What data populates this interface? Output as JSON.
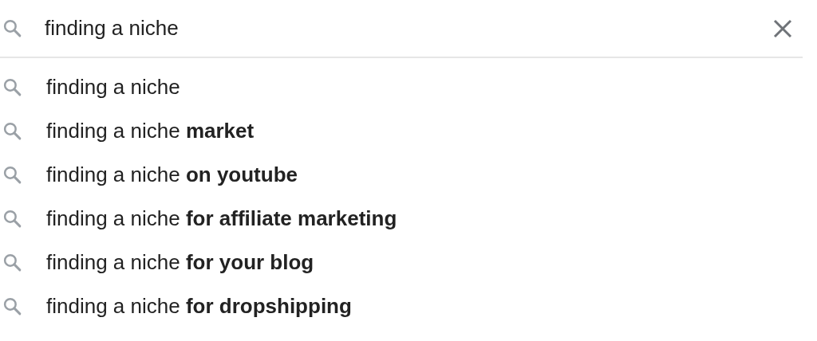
{
  "search": {
    "value": "finding a niche"
  },
  "suggestions": [
    {
      "text": "finding a niche"
    },
    {
      "text": "finding a niche **market**"
    },
    {
      "text": "finding a niche **on youtube**"
    },
    {
      "text": "finding a niche **for affiliate marketing**"
    },
    {
      "text": "finding a niche **for your blog**"
    },
    {
      "text": "finding a niche **for dropshipping**"
    }
  ]
}
